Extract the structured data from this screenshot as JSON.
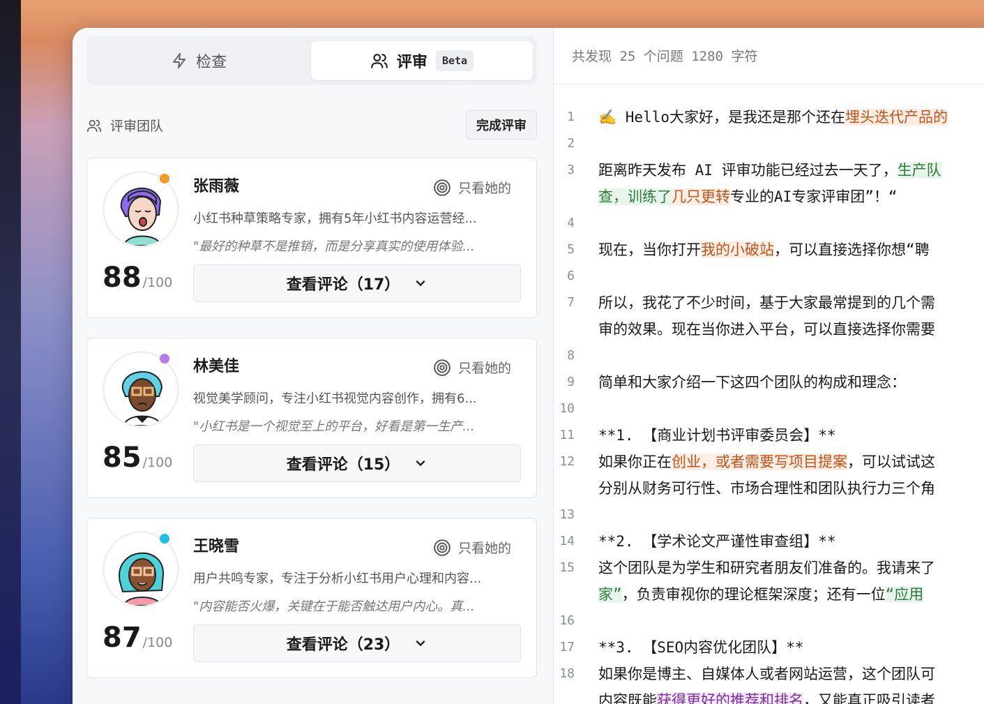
{
  "tabs": {
    "check_label": "检查",
    "review_label": "评审",
    "beta_badge": "Beta"
  },
  "team": {
    "label": "评审团队",
    "finish_button": "完成评审"
  },
  "reviewers": [
    {
      "name": "张雨薇",
      "filter_label": "只看她的",
      "description": "小红书种草策略专家，拥有5年小红书内容运营经...",
      "quote": "\"最好的种草不是推销，而是分享真实的使用体验...",
      "score": "88",
      "score_denominator": "/100",
      "view_button": "查看评论（17）",
      "dot_color": "#f59a23",
      "hair_color": "#8b6cf0"
    },
    {
      "name": "林美佳",
      "filter_label": "只看她的",
      "description": "视觉美学顾问，专注小红书视觉内容创作，拥有6...",
      "quote": "\"小红书是一个视觉至上的平台，好看是第一生产...",
      "score": "85",
      "score_denominator": "/100",
      "view_button": "查看评论（15）",
      "dot_color": "#b57bea",
      "hair_color": "#5fd3e3"
    },
    {
      "name": "王晓雪",
      "filter_label": "只看她的",
      "description": "用户共鸣专家，专注于分析小红书用户心理和内容...",
      "quote": "\"内容能否火爆，关键在于能否触达用户内心。真...",
      "score": "87",
      "score_denominator": "/100",
      "view_button": "查看评论（23）",
      "dot_color": "#1ec0e6",
      "hair_color": "#4fd1d9"
    }
  ],
  "editor": {
    "stats": "共发现 25 个问题  1280 字符",
    "lines": [
      {
        "n": "1",
        "parts": [
          {
            "t": "✍️ Hello大家好，是我还是那个还在"
          },
          {
            "t": "埋头迭代产品的",
            "hl": "orange"
          }
        ]
      },
      {
        "n": "2",
        "parts": []
      },
      {
        "n": "3",
        "parts": [
          {
            "t": "距离昨天发布 AI 评审功能已经过去一天了，"
          },
          {
            "t": "生产队",
            "hl": "green"
          }
        ]
      },
      {
        "n": "",
        "parts": [
          {
            "t": "查，训练了",
            "hl": "green"
          },
          {
            "t": "几只更转",
            "hl": "orange"
          },
          {
            "t": "专业的AI专家评审团”！“"
          }
        ]
      },
      {
        "n": "4",
        "parts": []
      },
      {
        "n": "5",
        "parts": [
          {
            "t": "现在，当你打开"
          },
          {
            "t": "我的小破站",
            "hl": "orange"
          },
          {
            "t": "，可以直接选择你想“聘"
          }
        ]
      },
      {
        "n": "6",
        "parts": []
      },
      {
        "n": "7",
        "parts": [
          {
            "t": "所以，我花了不少时间，基于大家最常提到的几个需"
          }
        ]
      },
      {
        "n": "",
        "parts": [
          {
            "t": "审的效果。现在当你进入平台，可以直接选择你需要"
          }
        ]
      },
      {
        "n": "8",
        "parts": []
      },
      {
        "n": "9",
        "parts": [
          {
            "t": "简单和大家介绍一下这四个团队的构成和理念："
          }
        ]
      },
      {
        "n": "10",
        "parts": []
      },
      {
        "n": "11",
        "parts": [
          {
            "t": "**1. 【商业计划书评审委员会】**"
          }
        ]
      },
      {
        "n": "12",
        "parts": [
          {
            "t": "如果你正在"
          },
          {
            "t": "创业，或者需要写项目提案",
            "hl": "orange"
          },
          {
            "t": "，可以试试这"
          }
        ]
      },
      {
        "n": "",
        "parts": [
          {
            "t": "分别从财务可行性、市场合理性和团队执行力三个角"
          }
        ]
      },
      {
        "n": "13",
        "parts": []
      },
      {
        "n": "14",
        "parts": [
          {
            "t": "**2. 【学术论文严谨性审查组】**"
          }
        ]
      },
      {
        "n": "15",
        "parts": [
          {
            "t": "这个团队是为学生和研究者朋友们准备的。我请来了"
          }
        ]
      },
      {
        "n": "",
        "parts": [
          {
            "t": "家”",
            "hl": "green"
          },
          {
            "t": "，负责审视你的理论框架深度；还有一位"
          },
          {
            "t": "“应用",
            "hl": "green"
          }
        ]
      },
      {
        "n": "16",
        "parts": []
      },
      {
        "n": "17",
        "parts": [
          {
            "t": "**3. 【SEO内容优化团队】**"
          }
        ]
      },
      {
        "n": "18",
        "parts": [
          {
            "t": "如果你是博主、自媒体人或者网站运营，这个团队可"
          }
        ]
      },
      {
        "n": "",
        "parts": [
          {
            "t": "内容既能"
          },
          {
            "t": "获得更好的推荐和排名",
            "hl": "purple"
          },
          {
            "t": "，又能真正吸引读者"
          }
        ]
      }
    ]
  }
}
